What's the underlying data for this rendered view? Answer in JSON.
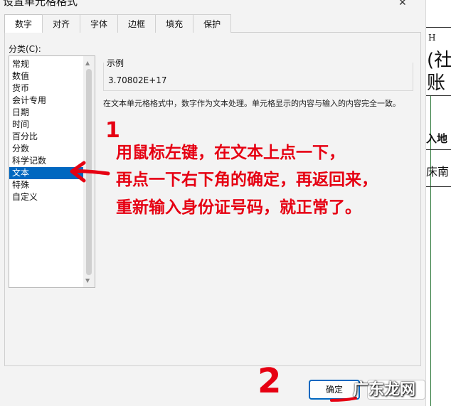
{
  "dialog": {
    "title": "设置单元格格式",
    "close_glyph": "✕",
    "tabs": [
      "数字",
      "对齐",
      "字体",
      "边框",
      "填充",
      "保护"
    ],
    "active_tab": 0,
    "category_label": "分类(C):",
    "categories": [
      "常规",
      "数值",
      "货币",
      "会计专用",
      "日期",
      "时间",
      "百分比",
      "分数",
      "科学记数",
      "文本",
      "特殊",
      "自定义"
    ],
    "selected_category": 9,
    "sample_label": "示例",
    "sample_value": "3.70802E+17",
    "description": "在文本单元格格式中，数字作为文本处理。单元格显示的内容与输入的内容完全一致。",
    "ok_label": "确定"
  },
  "sheet": {
    "col_header": "H",
    "text1": "(社",
    "text2": "账",
    "text3": "入地",
    "text4": "床南"
  },
  "annotations": {
    "line1": "用鼠标左键，在文本上点一下，",
    "line2": "再点一下右下角的确定，再返回来，",
    "line3": "重新输入身份证号码，就正常了。",
    "step1": "1",
    "step2": "2"
  },
  "watermark": "广东龙网",
  "colors": {
    "accent": "#0067c0",
    "annotation": "#e60012",
    "dialog_bg": "#f3f3f3"
  }
}
